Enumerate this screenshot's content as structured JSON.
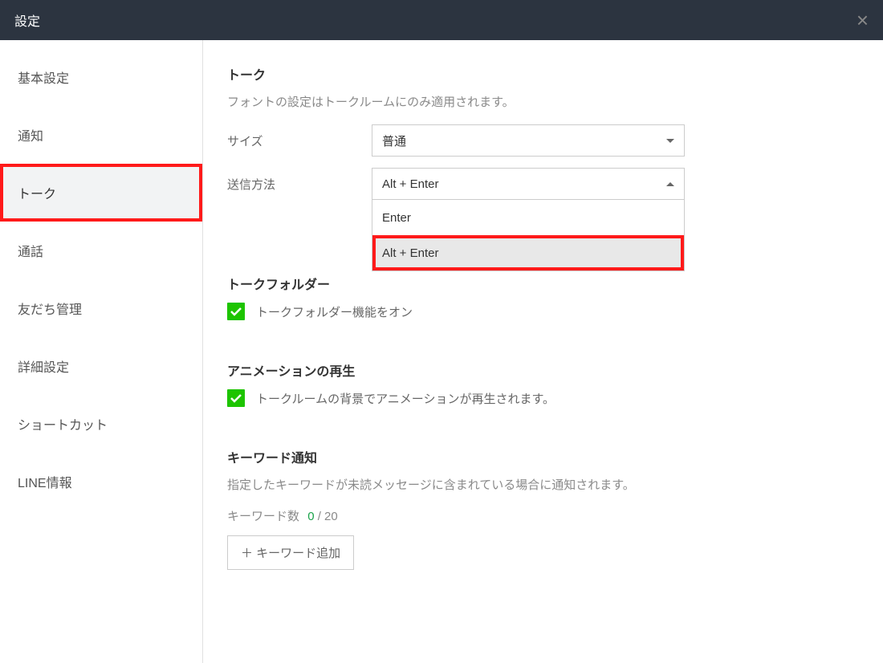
{
  "header": {
    "title": "設定"
  },
  "sidebar": {
    "items": [
      {
        "label": "基本設定"
      },
      {
        "label": "通知"
      },
      {
        "label": "トーク",
        "active": true
      },
      {
        "label": "通話"
      },
      {
        "label": "友だち管理"
      },
      {
        "label": "詳細設定"
      },
      {
        "label": "ショートカット"
      },
      {
        "label": "LINE情報"
      }
    ]
  },
  "talk": {
    "title": "トーク",
    "desc": "フォントの設定はトークルームにのみ適用されます。",
    "size_label": "サイズ",
    "size_value": "普通",
    "send_label": "送信方法",
    "send_value": "Alt + Enter",
    "send_options": [
      "Enter",
      "Alt + Enter"
    ]
  },
  "folder": {
    "title": "トークフォルダー",
    "checkbox_label": "トークフォルダー機能をオン"
  },
  "animation": {
    "title": "アニメーションの再生",
    "checkbox_label": "トークルームの背景でアニメーションが再生されます。"
  },
  "keyword": {
    "title": "キーワード通知",
    "desc": "指定したキーワードが未読メッセージに含まれている場合に通知されます。",
    "count_label": "キーワード数",
    "current": "0",
    "max": "/ 20",
    "add_button": "＋ キーワード追加"
  }
}
